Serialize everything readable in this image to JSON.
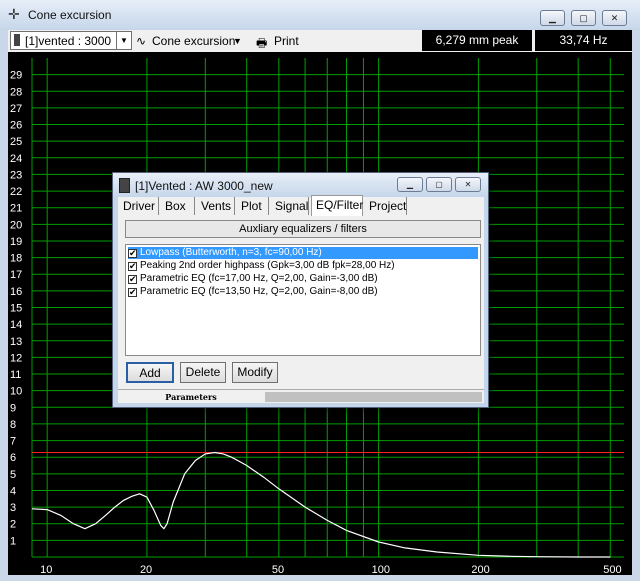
{
  "window": {
    "title": "Cone excursion",
    "icon": "crosshair-icon"
  },
  "toolbar": {
    "project_combo": "[1]vented : 3000",
    "plot_mode": "Cone excursion",
    "print_label": "Print",
    "readout_excursion": "6,279 mm peak",
    "readout_freq": "33,74 Hz"
  },
  "plot": {
    "y_ticks": [
      "29",
      "28",
      "27",
      "26",
      "25",
      "24",
      "23",
      "22",
      "21",
      "20",
      "19",
      "18",
      "17",
      "16",
      "15",
      "14",
      "13",
      "12",
      "11",
      "10",
      "9",
      "8",
      "7",
      "6",
      "5",
      "4",
      "3",
      "2",
      "1"
    ],
    "x_ticks": [
      "10",
      "20",
      "50",
      "100",
      "200",
      "500"
    ],
    "colors": {
      "grid": "#00a000",
      "curve": "#ffffff",
      "limit": "#ff2020",
      "background": "#000000"
    }
  },
  "chart_data": {
    "type": "line",
    "xscale": "log",
    "xlim": [
      9,
      550
    ],
    "ylim": [
      0,
      30
    ],
    "series": [
      {
        "x": [
          9,
          10,
          11,
          12,
          13,
          14,
          15,
          16,
          17,
          18,
          19,
          20,
          21,
          22,
          22.5,
          23,
          24,
          26,
          28,
          30,
          32,
          34,
          36,
          38,
          40,
          45,
          50,
          60,
          70,
          80,
          100,
          120,
          150,
          200,
          250,
          300,
          400,
          500
        ],
        "y": [
          2.9,
          2.85,
          2.5,
          2.0,
          1.7,
          2.0,
          2.5,
          3.0,
          3.4,
          3.65,
          3.8,
          3.6,
          2.8,
          1.9,
          1.7,
          2.0,
          3.3,
          5.0,
          5.8,
          6.2,
          6.28,
          6.2,
          6.0,
          5.75,
          5.5,
          4.8,
          4.1,
          3.0,
          2.2,
          1.6,
          0.9,
          0.55,
          0.3,
          0.1,
          0.04,
          0.02,
          0.0,
          0.0
        ]
      }
    ],
    "limit_line": 6.28
  },
  "dialog": {
    "title": "[1]Vented : AW 3000_new",
    "tabs": [
      "Driver",
      "Box",
      "Vents",
      "Plot",
      "Signal",
      "EQ/Filter",
      "Project"
    ],
    "active_tab": "EQ/Filter",
    "section_header": "Auxliary equalizers / filters",
    "filters": [
      "Lowpass (Butterworth, n=3, fc=90,00 Hz)",
      "Peaking 2nd order highpass (Gpk=3,00 dB fpk=28,00 Hz)",
      "Parametric EQ (fc=17,00 Hz, Q=2,00, Gain=-3,00 dB)",
      "Parametric EQ (fc=13,50 Hz, Q=2,00, Gain=-8,00 dB)"
    ],
    "buttons": {
      "add": "Add",
      "delete": "Delete",
      "modify": "Modify"
    },
    "status_left": "Parameters"
  }
}
